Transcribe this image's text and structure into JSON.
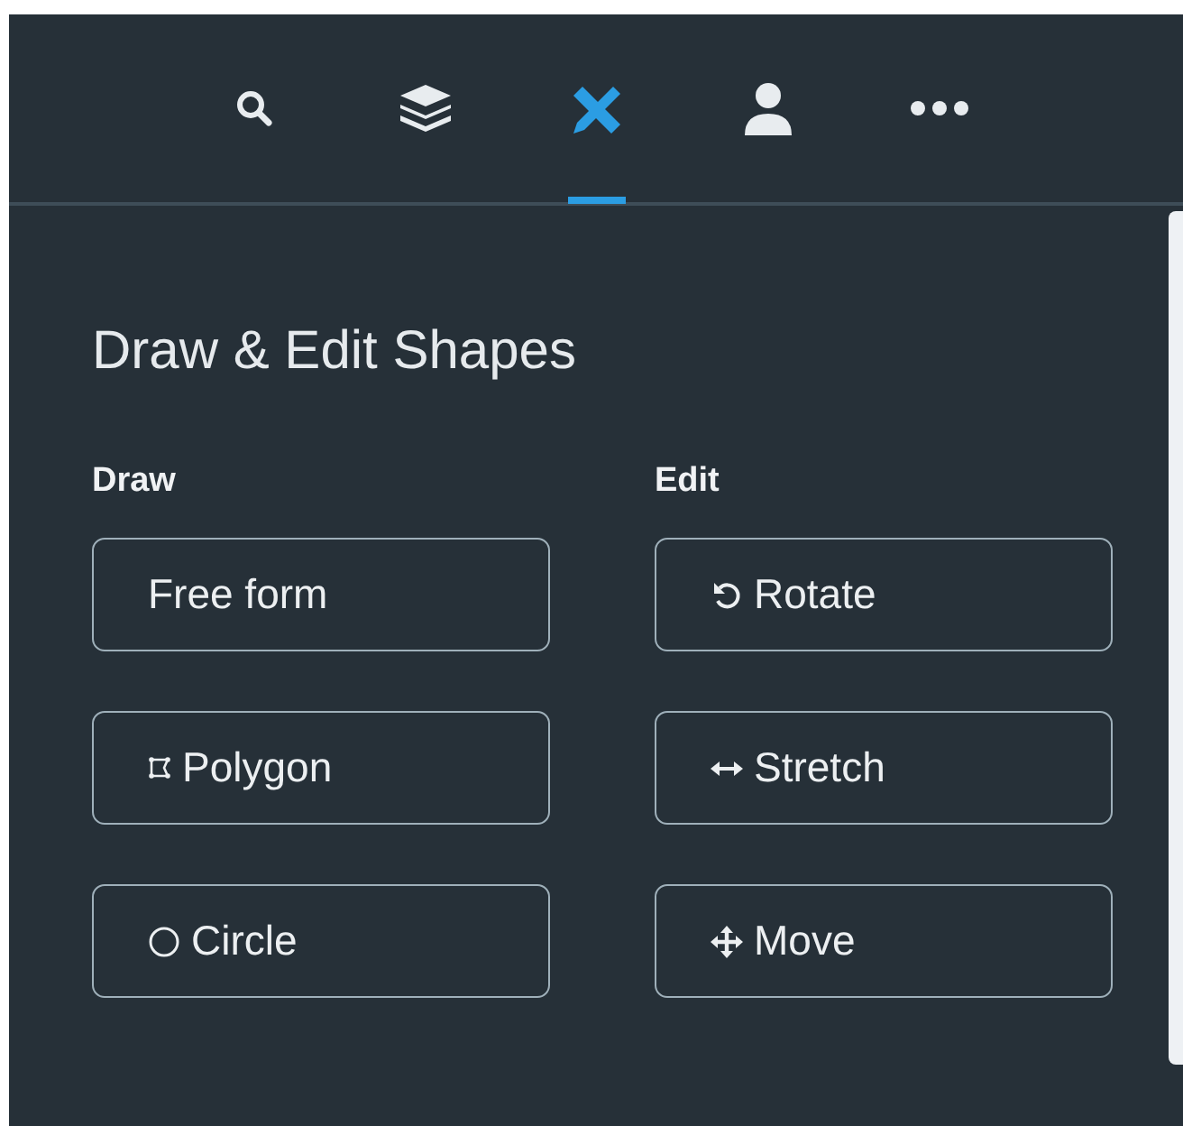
{
  "tabs": [
    {
      "kind": "search",
      "selected": false
    },
    {
      "kind": "layers",
      "selected": false
    },
    {
      "kind": "draw",
      "selected": true
    },
    {
      "kind": "user",
      "selected": false
    },
    {
      "kind": "more",
      "selected": false
    }
  ],
  "panel": {
    "title": "Draw & Edit Shapes",
    "columns": [
      {
        "heading": "Draw",
        "buttons": [
          {
            "kind": "plain",
            "label": "Free form"
          },
          {
            "kind": "polygon",
            "label": "Polygon"
          },
          {
            "kind": "circle",
            "label": "Circle"
          }
        ]
      },
      {
        "heading": "Edit",
        "buttons": [
          {
            "kind": "rotate",
            "label": "Rotate"
          },
          {
            "kind": "stretch",
            "label": "Stretch"
          },
          {
            "kind": "move",
            "label": "Move"
          }
        ]
      }
    ]
  }
}
